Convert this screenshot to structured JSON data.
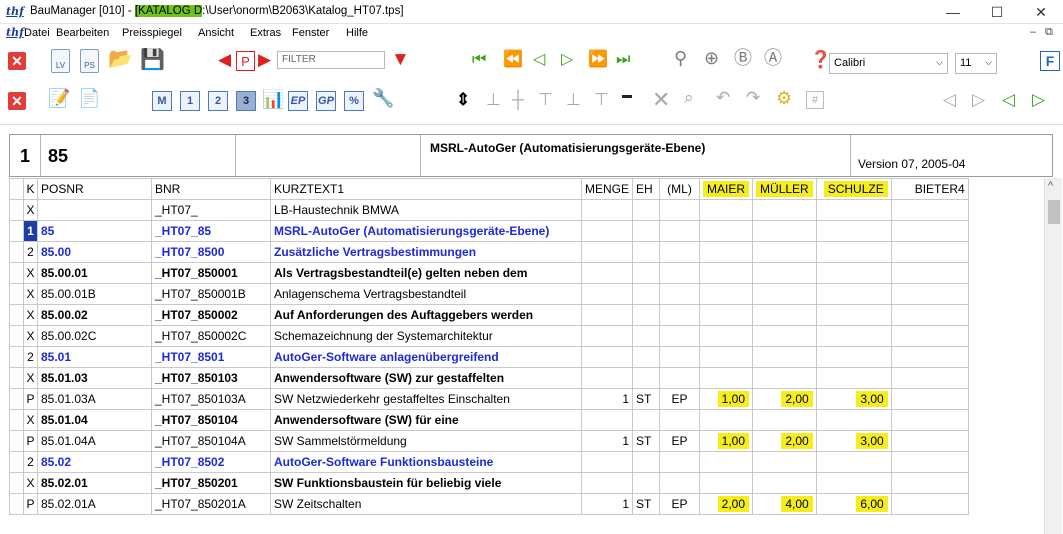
{
  "window": {
    "logo": "thf",
    "title_prefix": "BauManager [010] - ",
    "title_highlight": "[KATALOG D",
    "title_rest": ":\\User\\onorm\\B2063\\Katalog_HT07.tps]",
    "minimize": "—",
    "maximize": "☐",
    "close": "✕"
  },
  "menu": {
    "logo": "thf",
    "items": [
      "Datei",
      "Bearbeiten",
      "Preisspiegel",
      "Ansicht",
      "Extras",
      "Fenster",
      "Hilfe"
    ],
    "mdi_min": "–",
    "mdi_restore": "⧉"
  },
  "toolbar1": {
    "lv_label": "LV",
    "ps_label": "PS",
    "p_label": "P",
    "filter_placeholder": "FILTER",
    "font_name": "Calibri",
    "font_size": "11"
  },
  "toolbar2": {
    "m_label": "M",
    "one_label": "1",
    "two_label": "2",
    "three_label": "3",
    "ep_label": "EP",
    "gp_label": "GP",
    "pct_label": "%",
    "hash_label": "#"
  },
  "header": {
    "number": "1",
    "code": "85",
    "title": "MSRL-AutoGer (Automatisierungsgeräte-Ebene)",
    "version": "Version 07, 2005-04"
  },
  "grid": {
    "columns": [
      "K",
      "POSNR",
      "BNR",
      "KURZTEXT1",
      "MENGE",
      "EH",
      "(ML)",
      "MAIER",
      "MÜLLER",
      "SCHULZE",
      "BIETER4"
    ],
    "rows": [
      {
        "k": "X",
        "posnr": "",
        "bnr": "_HT07_",
        "text": "LB-Haustechnik BMWA",
        "menge": "",
        "eh": "",
        "ml": "",
        "maier": "",
        "mueller": "",
        "schulze": "",
        "style": "plain"
      },
      {
        "k": "1",
        "posnr": "85",
        "bnr": "_HT07_85",
        "text": "MSRL-AutoGer (Automatisierungsgeräte-Ebene)",
        "menge": "",
        "eh": "",
        "ml": "",
        "maier": "",
        "mueller": "",
        "schulze": "",
        "style": "blue",
        "selected": true
      },
      {
        "k": "2",
        "posnr": "85.00",
        "bnr": "_HT07_8500",
        "text": "Zusätzliche Vertragsbestimmungen",
        "menge": "",
        "eh": "",
        "ml": "",
        "maier": "",
        "mueller": "",
        "schulze": "",
        "style": "blue"
      },
      {
        "k": "X",
        "posnr": "85.00.01",
        "bnr": "_HT07_850001",
        "text": "Als Vertragsbestandteil(e) gelten neben dem",
        "menge": "",
        "eh": "",
        "ml": "",
        "maier": "",
        "mueller": "",
        "schulze": "",
        "style": "bold"
      },
      {
        "k": "X",
        "posnr": "85.00.01B",
        "bnr": "_HT07_850001B",
        "text": "Anlagenschema Vertragsbestandteil",
        "menge": "",
        "eh": "",
        "ml": "",
        "maier": "",
        "mueller": "",
        "schulze": "",
        "style": "plain"
      },
      {
        "k": "X",
        "posnr": "85.00.02",
        "bnr": "_HT07_850002",
        "text": "Auf Anforderungen des Auftaggebers werden",
        "menge": "",
        "eh": "",
        "ml": "",
        "maier": "",
        "mueller": "",
        "schulze": "",
        "style": "bold"
      },
      {
        "k": "X",
        "posnr": "85.00.02C",
        "bnr": "_HT07_850002C",
        "text": "Schemazeichnung der Systemarchitektur",
        "menge": "",
        "eh": "",
        "ml": "",
        "maier": "",
        "mueller": "",
        "schulze": "",
        "style": "plain"
      },
      {
        "k": "2",
        "posnr": "85.01",
        "bnr": "_HT07_8501",
        "text": "AutoGer-Software anlagenübergreifend",
        "menge": "",
        "eh": "",
        "ml": "",
        "maier": "",
        "mueller": "",
        "schulze": "",
        "style": "blue"
      },
      {
        "k": "X",
        "posnr": "85.01.03",
        "bnr": "_HT07_850103",
        "text": "Anwendersoftware (SW) zur gestaffelten",
        "menge": "",
        "eh": "",
        "ml": "",
        "maier": "",
        "mueller": "",
        "schulze": "",
        "style": "bold"
      },
      {
        "k": "P",
        "posnr": "85.01.03A",
        "bnr": "_HT07_850103A",
        "text": "SW Netzwiederkehr gestaffeltes Einschalten",
        "menge": "1",
        "eh": "ST",
        "ml": "EP",
        "maier": "1,00",
        "mueller": "2,00",
        "schulze": "3,00",
        "style": "plain"
      },
      {
        "k": "X",
        "posnr": "85.01.04",
        "bnr": "_HT07_850104",
        "text": "Anwendersoftware (SW) für eine",
        "menge": "",
        "eh": "",
        "ml": "",
        "maier": "",
        "mueller": "",
        "schulze": "",
        "style": "bold"
      },
      {
        "k": "P",
        "posnr": "85.01.04A",
        "bnr": "_HT07_850104A",
        "text": "SW Sammelstörmeldung",
        "menge": "1",
        "eh": "ST",
        "ml": "EP",
        "maier": "1,00",
        "mueller": "2,00",
        "schulze": "3,00",
        "style": "plain"
      },
      {
        "k": "2",
        "posnr": "85.02",
        "bnr": "_HT07_8502",
        "text": "AutoGer-Software Funktionsbausteine",
        "menge": "",
        "eh": "",
        "ml": "",
        "maier": "",
        "mueller": "",
        "schulze": "",
        "style": "blue"
      },
      {
        "k": "X",
        "posnr": "85.02.01",
        "bnr": "_HT07_850201",
        "text": "SW Funktionsbaustein für beliebig viele",
        "menge": "",
        "eh": "",
        "ml": "",
        "maier": "",
        "mueller": "",
        "schulze": "",
        "style": "bold"
      },
      {
        "k": "P",
        "posnr": "85.02.01A",
        "bnr": "_HT07_850201A",
        "text": "SW Zeitschalten",
        "menge": "1",
        "eh": "ST",
        "ml": "EP",
        "maier": "2,00",
        "mueller": "4,00",
        "schulze": "6,00",
        "style": "plain"
      }
    ]
  },
  "colors": {
    "title_highlight": "#6ec31b",
    "bidder_highlight": "#f6ee1c",
    "blue_text": "#1c2ad8",
    "selected_row": "#1d3ea8"
  }
}
